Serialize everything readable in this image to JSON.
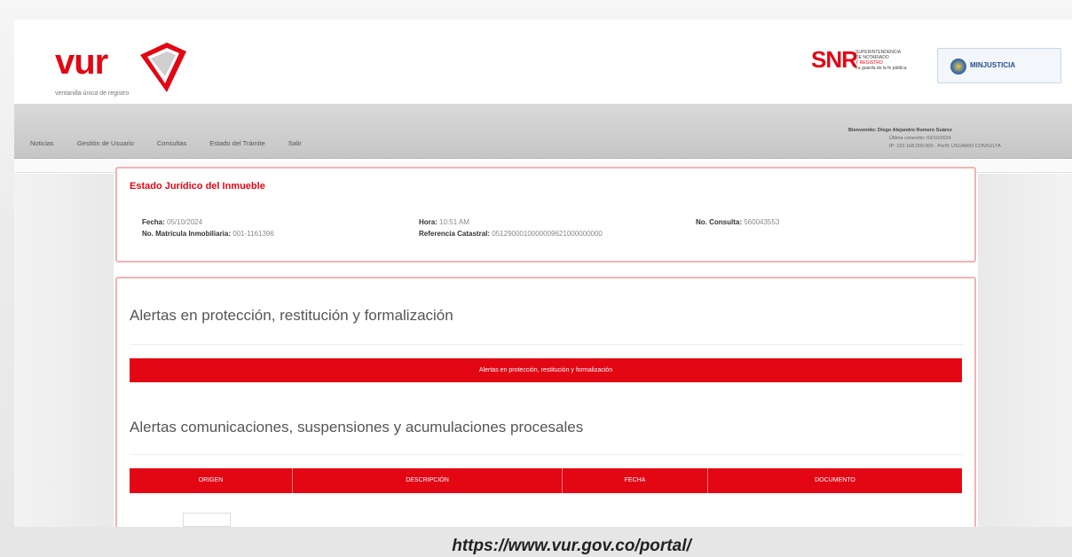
{
  "branding": {
    "vur_logo": "vur",
    "vur_tagline": "ventanilla única de registro",
    "snr_logo": "SNR",
    "snr_lines": [
      "SUPERINTENDENCIA",
      "DE NOTARIADO",
      "Y REGISTRO",
      "La guarda de la fe pública"
    ],
    "minjusticia_logo": "MINJUSTICIA"
  },
  "nav": {
    "items": [
      "Noticias",
      "Gestión de Usuario",
      "Consultas",
      "Estado del Trámite",
      "Salir"
    ]
  },
  "user": {
    "welcome": "Bienvenido: Diego Alejandro Romero Suárez",
    "line2": "Última conexión: 03/10/2024",
    "line3": "IP: 192.168.000.000 · Perfil: USUARIO CONSULTA"
  },
  "legal_status": {
    "title": "Estado Jurídico del Inmueble",
    "fecha_label": "Fecha:",
    "fecha_value": "05/10/2024",
    "hora_label": "Hora:",
    "hora_value": "10:51 AM",
    "consulta_label": "No. Consulta:",
    "consulta_value": "560043553",
    "matricula_label": "No. Matrícula Inmobiliaria:",
    "matricula_value": "001-1161396",
    "catastral_label": "Referencia Catastral:",
    "catastral_value": "0512900010000009621000000000"
  },
  "alerts": {
    "section1_title": "Alertas en protección, restitución y formalización",
    "section1_bar": "Alertas en protección, restitución y formalización",
    "section2_title": "Alertas comunicaciones, suspensiones y acumulaciones procesales",
    "table_headers": [
      "ORIGEN",
      "DESCRIPCIÓN",
      "FECHA",
      "DOCUMENTO"
    ]
  },
  "caption": {
    "url": "https://www.vur.gov.co/portal/"
  },
  "colors": {
    "brand_red": "#e30613",
    "card_border": "#f2b3b3"
  }
}
